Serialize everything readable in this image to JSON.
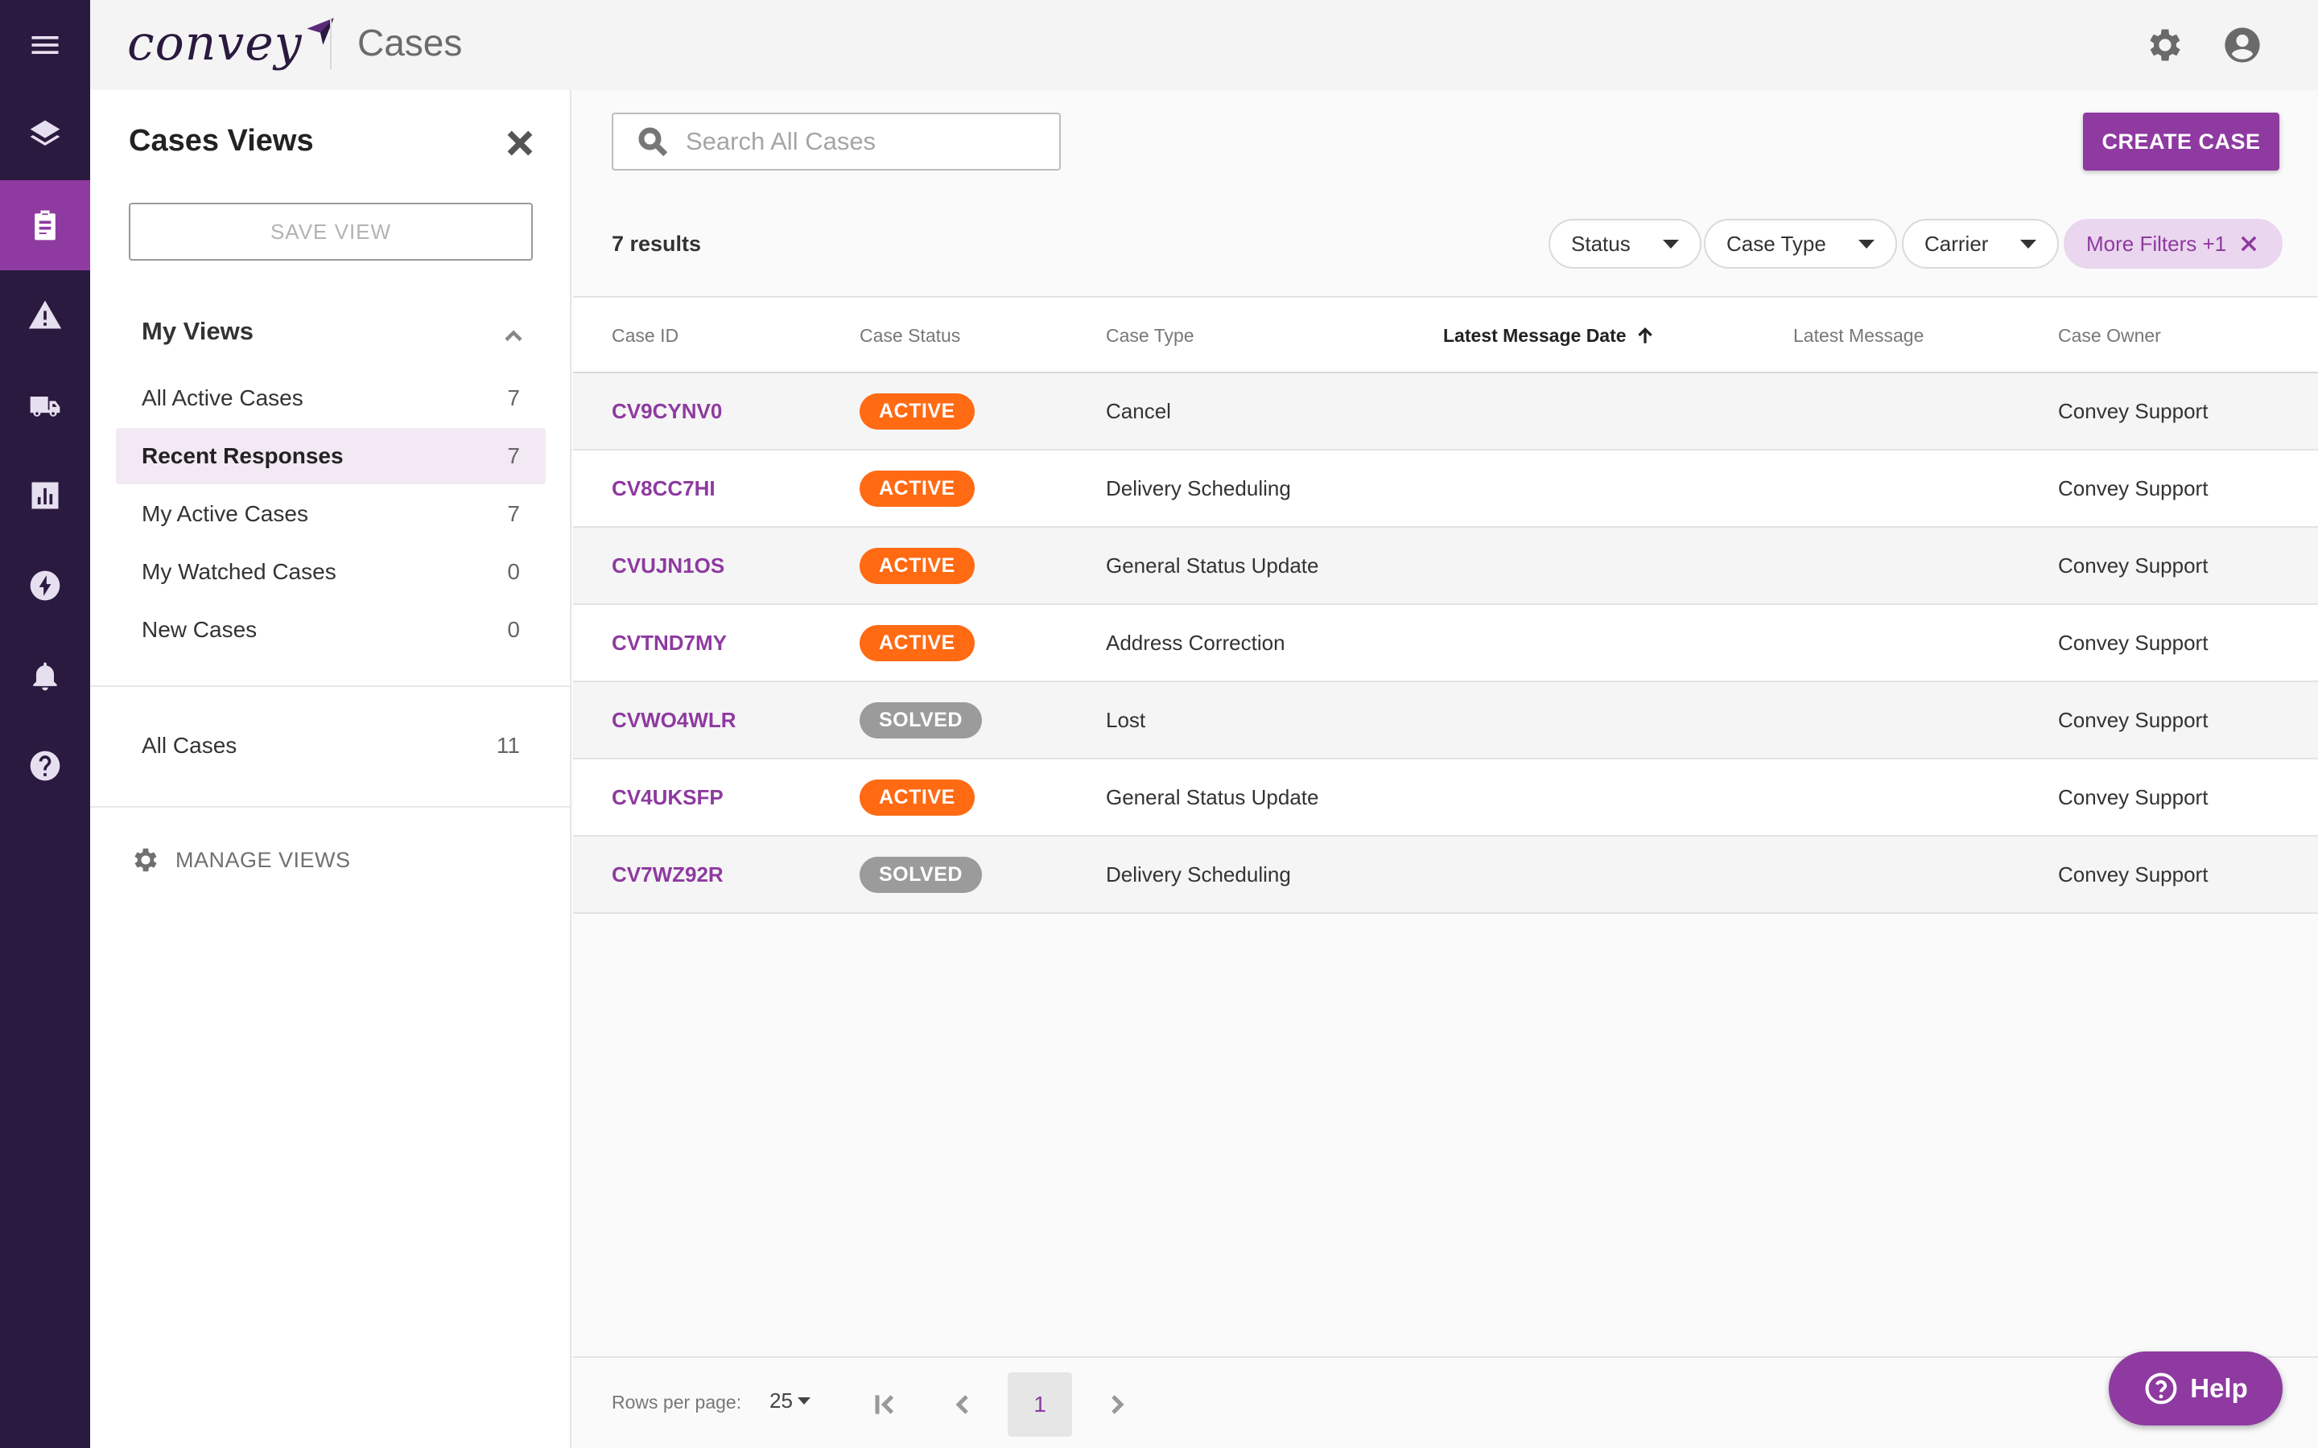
{
  "app": {
    "logo_text": "convey",
    "page_title": "Cases"
  },
  "rail": {
    "items": [
      "menu-icon",
      "layers-icon",
      "clipboard-icon",
      "warning-icon",
      "truck-icon",
      "chart-icon",
      "bolt-icon",
      "bell-icon",
      "help-circle-icon"
    ],
    "active": "clipboard-icon"
  },
  "views_panel": {
    "title": "Cases Views",
    "save_view_label": "SAVE VIEW",
    "my_views_header": "My Views",
    "my_views": [
      {
        "label": "All Active Cases",
        "count": "7"
      },
      {
        "label": "Recent Responses",
        "count": "7",
        "selected": true
      },
      {
        "label": "My Active Cases",
        "count": "7"
      },
      {
        "label": "My Watched Cases",
        "count": "0"
      },
      {
        "label": "New Cases",
        "count": "0"
      }
    ],
    "all_cases": {
      "label": "All Cases",
      "count": "11"
    },
    "manage_views_label": "MANAGE VIEWS"
  },
  "main": {
    "search_placeholder": "Search All Cases",
    "create_button": "CREATE CASE",
    "results_label": "7 results",
    "filters": {
      "status": "Status",
      "case_type": "Case Type",
      "carrier": "Carrier",
      "more": "More Filters +1"
    },
    "columns": [
      "Case ID",
      "Case Status",
      "Case Type",
      "Latest Message Date",
      "Latest Message",
      "Case Owner"
    ],
    "rows": [
      {
        "id": "CV9CYNV0",
        "status": "ACTIVE",
        "type": "Cancel",
        "date": "",
        "message": "",
        "owner": "Convey Support"
      },
      {
        "id": "CV8CC7HI",
        "status": "ACTIVE",
        "type": "Delivery Scheduling",
        "date": "",
        "message": "",
        "owner": "Convey Support"
      },
      {
        "id": "CVUJN1OS",
        "status": "ACTIVE",
        "type": "General Status Update",
        "date": "",
        "message": "",
        "owner": "Convey Support"
      },
      {
        "id": "CVTND7MY",
        "status": "ACTIVE",
        "type": "Address Correction",
        "date": "",
        "message": "",
        "owner": "Convey Support"
      },
      {
        "id": "CVWO4WLR",
        "status": "SOLVED",
        "type": "Lost",
        "date": "",
        "message": "",
        "owner": "Convey Support"
      },
      {
        "id": "CV4UKSFP",
        "status": "ACTIVE",
        "type": "General Status Update",
        "date": "",
        "message": "",
        "owner": "Convey Support"
      },
      {
        "id": "CV7WZ92R",
        "status": "SOLVED",
        "type": "Delivery Scheduling",
        "date": "",
        "message": "",
        "owner": "Convey Support"
      }
    ],
    "footer": {
      "rows_per_page_label": "Rows per page:",
      "rows_per_page_value": "25",
      "current_page": "1"
    },
    "help_label": "Help"
  },
  "colors": {
    "rail_bg": "#2b1a3f",
    "accent": "#8e3aa0",
    "active_badge": "#ff6a13",
    "solved_badge": "#9b9b9b"
  }
}
